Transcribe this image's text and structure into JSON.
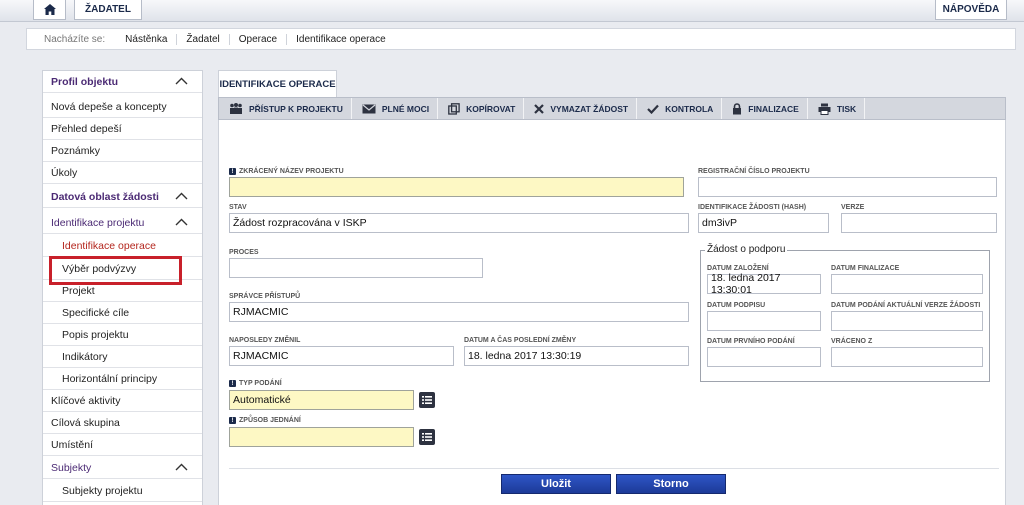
{
  "topbar": {
    "home_icon": "home-icon",
    "zadatel_label": "ŽADATEL",
    "napoveda_label": "NÁPOVĚDA"
  },
  "breadcrumb": {
    "label": "Nacházíte se:",
    "items": [
      "Nástěnka",
      "Žadatel",
      "Operace",
      "Identifikace operace"
    ]
  },
  "sidebar": {
    "items": [
      {
        "label": "Profil objektu",
        "kind": "head"
      },
      {
        "label": "Nová depeše a koncepty"
      },
      {
        "label": "Přehled depeší"
      },
      {
        "label": "Poznámky"
      },
      {
        "label": "Úkoly"
      },
      {
        "label": "Datová oblast žádosti",
        "kind": "head"
      },
      {
        "label": "Identifikace projektu",
        "kind": "head-light"
      },
      {
        "label": "Identifikace operace",
        "kind": "sub-active"
      },
      {
        "label": "Výběr podvýzvy",
        "kind": "sub"
      },
      {
        "label": "Projekt",
        "kind": "sub"
      },
      {
        "label": "Specifické cíle",
        "kind": "sub"
      },
      {
        "label": "Popis projektu",
        "kind": "sub"
      },
      {
        "label": "Indikátory",
        "kind": "sub"
      },
      {
        "label": "Horizontální principy",
        "kind": "sub"
      },
      {
        "label": "Klíčové aktivity"
      },
      {
        "label": "Cílová skupina"
      },
      {
        "label": "Umístění"
      },
      {
        "label": "Subjekty",
        "kind": "head-light"
      },
      {
        "label": "Subjekty projektu",
        "kind": "sub"
      }
    ]
  },
  "tab": {
    "label": "IDENTIFIKACE OPERACE"
  },
  "toolbar": {
    "access": "PŘÍSTUP K PROJEKTU",
    "power": "PLNÉ MOCI",
    "copy": "KOPÍROVAT",
    "delete": "VYMAZAT ŽÁDOST",
    "check": "KONTROLA",
    "finalize": "FINALIZACE",
    "print": "TISK"
  },
  "form": {
    "short_name": {
      "label": "ZKRÁCENÝ NÁZEV PROJEKTU",
      "value": ""
    },
    "state": {
      "label": "STAV",
      "value": "Žádost rozpracována v ISKP"
    },
    "process": {
      "label": "PROCES",
      "value": ""
    },
    "access_admin": {
      "label": "SPRÁVCE PŘÍSTUPŮ",
      "value": "RJMACMIC"
    },
    "last_changed_by": {
      "label": "NAPOSLEDY ZMĚNIL",
      "value": "RJMACMIC"
    },
    "last_change_date": {
      "label": "DATUM A ČAS POSLEDNÍ ZMĚNY",
      "value": "18. ledna 2017 13:30:19"
    },
    "submission_type": {
      "label": "TYP PODÁNÍ",
      "value": "Automatické"
    },
    "negotiation_method": {
      "label": "ZPŮSOB JEDNÁNÍ",
      "value": ""
    },
    "reg_number": {
      "label": "REGISTRAČNÍ ČÍSLO PROJEKTU",
      "value": ""
    },
    "hash": {
      "label": "IDENTIFIKACE ŽÁDOSTI (HASH)",
      "value": "dm3ivP"
    },
    "version": {
      "label": "VERZE",
      "value": ""
    },
    "support_request": {
      "legend": "Žádost o podporu",
      "created": {
        "label": "DATUM ZALOŽENÍ",
        "value": "18. ledna 2017 13:30:01"
      },
      "finalized": {
        "label": "DATUM FINALIZACE",
        "value": ""
      },
      "signed": {
        "label": "DATUM PODPISU",
        "value": ""
      },
      "current_submitted": {
        "label": "DATUM PODÁNÍ AKTUÁLNÍ VERZE ŽÁDOSTI",
        "value": ""
      },
      "first_submitted": {
        "label": "DATUM PRVNÍHO PODÁNÍ",
        "value": ""
      },
      "returned": {
        "label": "VRÁCENO Z",
        "value": ""
      }
    }
  },
  "buttons": {
    "save": "Uložit",
    "cancel": "Storno"
  },
  "colors": {
    "required_field": "#fdf8c4",
    "accent_blue": "#2547b0",
    "highlight_red": "#c8202a",
    "nav_purple": "#4b2a74"
  }
}
